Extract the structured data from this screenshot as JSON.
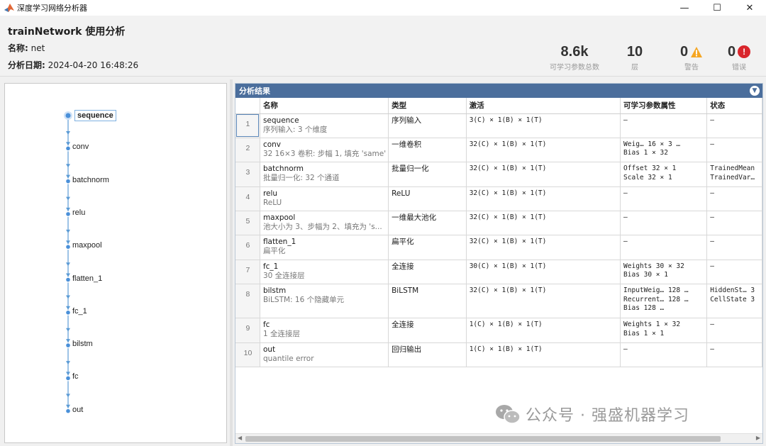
{
  "window": {
    "title": "深度学习网络分析器",
    "controls": {
      "minimize": "—",
      "maximize": "☐",
      "close": "✕"
    }
  },
  "header": {
    "title": "trainNetwork 使用分析",
    "name_label": "名称:",
    "name_value": "net",
    "date_label": "分析日期:",
    "date_value": "2024-04-20 16:48:26"
  },
  "stats": {
    "params": {
      "value": "8.6k",
      "label": "可学习参数总数"
    },
    "layers": {
      "value": "10",
      "label": "层"
    },
    "warnings": {
      "value": "0",
      "label": "警告"
    },
    "errors": {
      "value": "0",
      "label": "错误"
    }
  },
  "graph": {
    "nodes": [
      {
        "label": "sequence",
        "selected": true
      },
      {
        "label": "conv"
      },
      {
        "label": "batchnorm"
      },
      {
        "label": "relu"
      },
      {
        "label": "maxpool"
      },
      {
        "label": "flatten_1"
      },
      {
        "label": "fc_1"
      },
      {
        "label": "bilstm"
      },
      {
        "label": "fc"
      },
      {
        "label": "out"
      }
    ],
    "colors": {
      "edge": "#5b9bd5",
      "node": "#4a90d9"
    }
  },
  "results": {
    "panel_title": "分析结果",
    "columns": [
      "",
      "名称",
      "类型",
      "激活",
      "可学习参数属性",
      "状态"
    ],
    "rows": [
      {
        "idx": "1",
        "name": "sequence",
        "desc": "序列输入: 3 个维度",
        "type": "序列输入",
        "act": "3(C) × 1(B) × 1(T)",
        "params": [
          "–"
        ],
        "state": [
          "–"
        ]
      },
      {
        "idx": "2",
        "name": "conv",
        "desc": "32 16×3 卷积: 步幅 1, 填充 'same'",
        "type": "一维卷积",
        "act": "32(C) × 1(B) × 1(T)",
        "params": [
          "Weig…  16 × 3 …",
          "Bias    1 × 32"
        ],
        "state": [
          "–"
        ]
      },
      {
        "idx": "3",
        "name": "batchnorm",
        "desc": "批量归一化: 32 个通道",
        "type": "批量归一化",
        "act": "32(C) × 1(B) × 1(T)",
        "params": [
          "Offset  32 × 1",
          "Scale   32 × 1"
        ],
        "state": [
          "TrainedMean",
          "TrainedVar…"
        ]
      },
      {
        "idx": "4",
        "name": "relu",
        "desc": "ReLU",
        "type": "ReLU",
        "act": "32(C) × 1(B) × 1(T)",
        "params": [
          "–"
        ],
        "state": [
          "–"
        ]
      },
      {
        "idx": "5",
        "name": "maxpool",
        "desc": "池大小为 3、步幅为 2、填充为 's...",
        "type": "一维最大池化",
        "act": "32(C) × 1(B) × 1(T)",
        "params": [
          "–"
        ],
        "state": [
          "–"
        ]
      },
      {
        "idx": "6",
        "name": "flatten_1",
        "desc": "扁平化",
        "type": "扁平化",
        "act": "32(C) × 1(B) × 1(T)",
        "params": [
          "–"
        ],
        "state": [
          "–"
        ]
      },
      {
        "idx": "7",
        "name": "fc_1",
        "desc": "30 全连接层",
        "type": "全连接",
        "act": "30(C) × 1(B) × 1(T)",
        "params": [
          "Weights  30 × 32",
          "Bias     30 × 1"
        ],
        "state": [
          "–"
        ]
      },
      {
        "idx": "8",
        "name": "bilstm",
        "desc": "BiLSTM: 16 个隐藏单元",
        "type": "BiLSTM",
        "act": "32(C) × 1(B) × 1(T)",
        "params": [
          "InputWeig…   128 …",
          "Recurrent…   128 …",
          "Bias         128 …"
        ],
        "state": [
          "HiddenSt…   3",
          "CellState   3"
        ]
      },
      {
        "idx": "9",
        "name": "fc",
        "desc": "1 全连接层",
        "type": "全连接",
        "act": "1(C) × 1(B) × 1(T)",
        "params": [
          "Weights  1 × 32",
          "Bias     1 × 1"
        ],
        "state": [
          "–"
        ]
      },
      {
        "idx": "10",
        "name": "out",
        "desc": "quantile error",
        "type": "回归输出",
        "act": "1(C) × 1(B) × 1(T)",
        "params": [
          "–"
        ],
        "state": [
          "–"
        ]
      }
    ]
  },
  "watermark": "公众号 · 强盛机器学习"
}
